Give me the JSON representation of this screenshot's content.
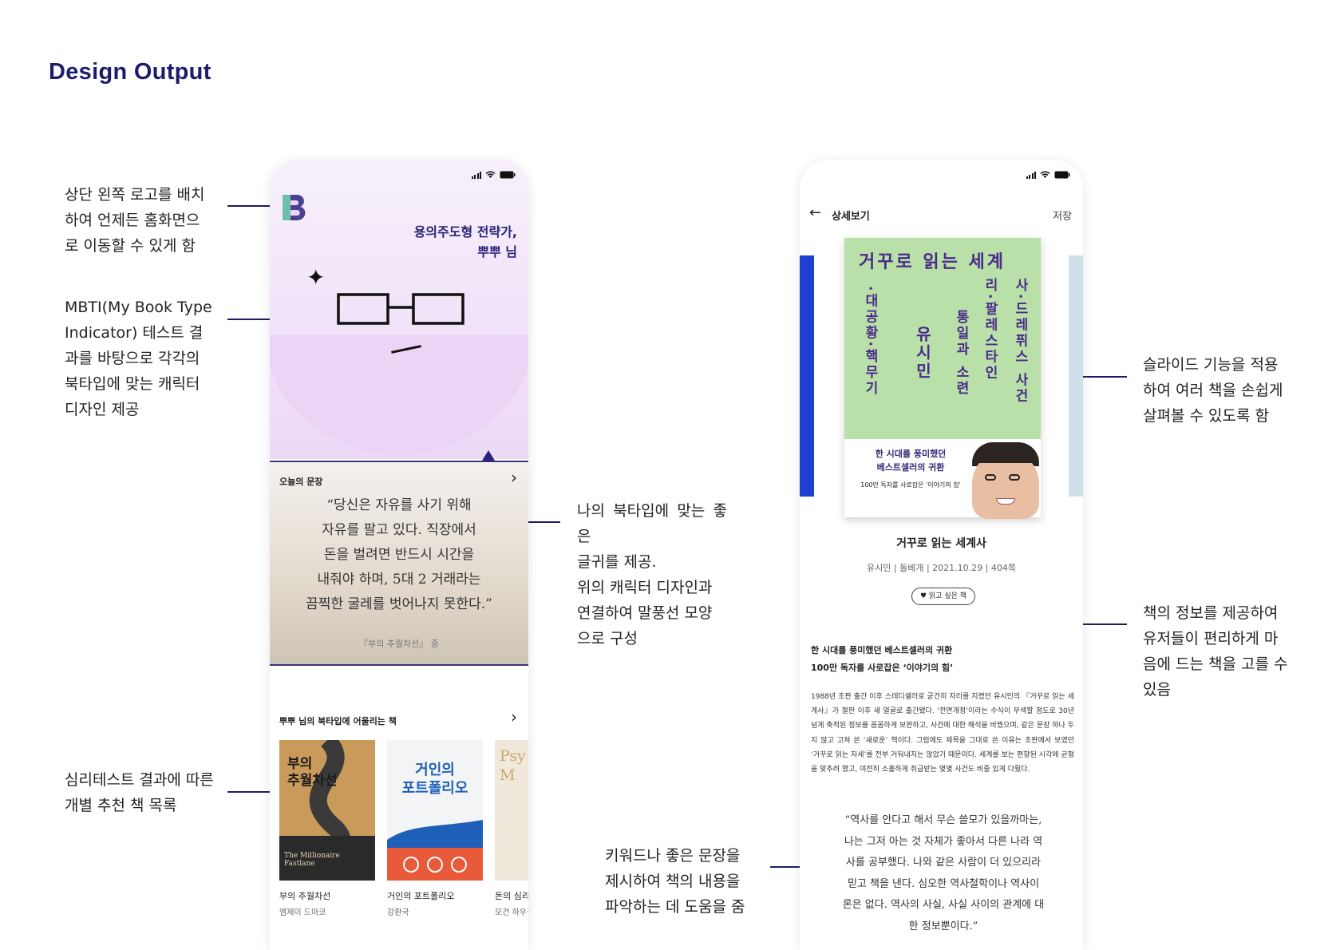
{
  "page": {
    "title": "Design Output"
  },
  "annotations": {
    "logo": "상단 왼쪽 로고를 배치\n하여 언제든 홈화면으\n로 이동할 수 있게 함",
    "mbti": "MBTI(My Book Type\nIndicator) 테스트 결\n과를 바탕으로 각각의\n북타입에 맞는 캐릭터\n디자인 제공",
    "quote": "나의 북타입에 맞는 좋은\n글귀를 제공.\n위의 캐릭터 디자인과\n연결하여 말풍선 모양\n으로 구성",
    "recommend": "심리테스트 결과에 따른\n개별 추천 책 목록",
    "slide": "슬라이드 기능을 적용\n하여 여러 책을 손쉽게\n살펴볼 수 있도록 함",
    "info": "책의 정보를 제공하여\n유저들이 편리하게 마\n음에 드는 책을 고를 수\n있음",
    "keyword": "키워드나 좋은 문장을\n제시하여 책의 내용을\n파악하는 데 도움을 줌"
  },
  "home": {
    "greeting_line1": "용의주도형 전략가,",
    "greeting_line2": "뿌뿌 님",
    "sparkle": "✦",
    "quote_section_label": "오늘의 문장",
    "quote_text": "“당신은 자유를 사기 위해\n자유를 팔고 있다. 직장에서\n돈을 벌려면 반드시 시간을\n내줘야 하며, 5대 2 거래라는\n끔찍한 굴레를 벗어나지 못한다.”",
    "quote_source": "『부의 추월차선』 중",
    "rec_section_label": "뿌뿌 님의 북타입에 어울리는 책",
    "chevron": "›",
    "books": [
      {
        "title": "부의 추월차선",
        "author": "엠제이 드마코",
        "cover_text": "부의\n추월차선",
        "cover_sub": "The Millionaire Fastlane"
      },
      {
        "title": "거인의 포트폴리오",
        "author": "강환국",
        "cover_text": "거인의\n포트폴리오",
        "cover_sub": ""
      },
      {
        "title": "돈의 심리학",
        "author": "모건 하우절",
        "cover_text": "Psy\nM",
        "cover_sub": ""
      }
    ]
  },
  "detail": {
    "nav_title": "상세보기",
    "save_label": "저장",
    "back_icon": "←",
    "cover_title": "거꾸로 읽는 세계",
    "cover_vertical_1": "사·드레퓌스 사건",
    "cover_vertical_2": "리·팔레스타인",
    "cover_vertical_3": "통일과 소련",
    "cover_vertical_4": "유시민",
    "cover_vertical_5": "·대공황·핵무기",
    "cover_tagline": "한 시대를 풍미했던\n베스트셀러의 귀환",
    "cover_small": "100만 독자를 사로잡은 '이야기의 힘'",
    "book_title": "거꾸로 읽는 세계사",
    "book_meta": "유시민 | 돌베개 | 2021.10.29 | 404쪽",
    "want_button": "♥ 읽고 싶은 책",
    "highlight": "한 시대를 풍미했던 베스트셀러의 귀환\n100만 독자를 사로잡은 ‘이야기의 힘’",
    "description": "1988년 초판 출간 이후 스테디셀러로 굳건히 자리를 지켰던 유시민의 『거꾸로 읽는 세계사』가 절판 이후 새 얼굴로 출간됐다. ‘전면개정’이라는 수식이 무색할 정도로 30년 넘게 축적된 정보를 꼼꼼하게 보완하고, 사건에 대한 해석을 바꿨으며, 같은 문장 하나 두지 않고 고쳐 쓴 ‘새로운’ 책이다. 그럼에도 제목을 그대로 쓴 이유는 초판에서 보였던 ‘거꾸로 읽는 자세’를 전부 거둬내지는 않았기 때문이다. 세계를 보는 편향된 시각에 균형을 맞추려 했고, 여전히 소홀하게 취급받는 몇몇 사건도 비중 있게 다뤘다.",
    "quote": "“역사를 안다고 해서 무슨 쓸모가 있을까마는,\n나는 그저 아는 것 자체가 좋아서 다른 나라 역\n사를 공부했다. 나와 같은 사람이 더 있으리라\n믿고 책을 낸다. 심오한 역사철학이나 역사이\n론은 없다. 역사의 사실, 사실 사이의 관계에 대\n한 정보뿐이다.”"
  },
  "colors": {
    "accent": "#1f1b6b",
    "hero": "#ecd4f6",
    "cover_green": "#b9e0a8"
  }
}
